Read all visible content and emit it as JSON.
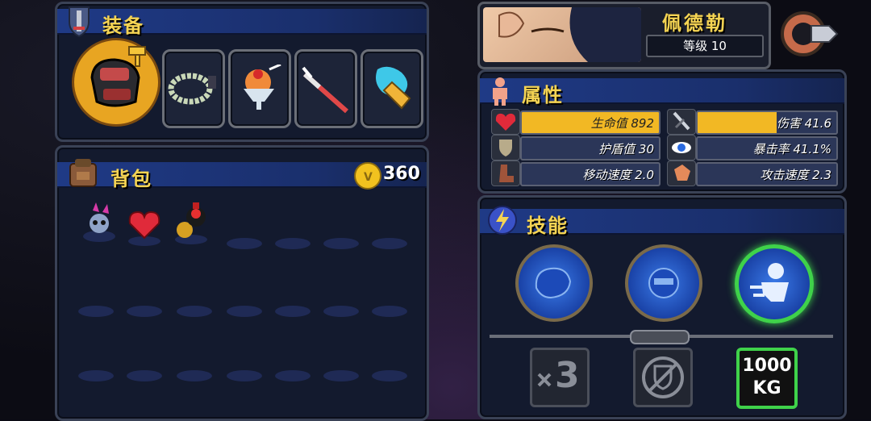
{
  "equipment": {
    "title": "装备",
    "slots": [
      "glove",
      "bracelet",
      "ice-cream",
      "spear",
      "flame-fist"
    ]
  },
  "backpack": {
    "title": "背包",
    "coins": "360",
    "items": [
      "skull-helmet",
      "heart",
      "potion"
    ]
  },
  "character": {
    "name": "佩德勒",
    "level": "等级 10"
  },
  "attributes": {
    "title": "属性",
    "left": [
      {
        "label": "生命值 892",
        "icon": "heart-icon",
        "fill": 1.0
      },
      {
        "label": "护盾值 30",
        "icon": "shield-icon",
        "fill": 0.0
      },
      {
        "label": "移动速度 2.0",
        "icon": "boot-icon",
        "fill": 0.0
      }
    ],
    "right": [
      {
        "label": "伤害 41.6",
        "icon": "sword-icon",
        "fill": 0.57
      },
      {
        "label": "暴击率 41.1%",
        "icon": "eye-icon",
        "fill": 0.0
      },
      {
        "label": "攻击速度 2.3",
        "icon": "fist-icon",
        "fill": 0.0
      }
    ]
  },
  "skills": {
    "title": "技能",
    "active": [
      "skill-punch",
      "skill-fist",
      "skill-dash"
    ],
    "passive": [
      "x3",
      "no-shield",
      "1000 KG"
    ],
    "passive_text": {
      "a": "3",
      "b": "1000",
      "c": "KG"
    }
  },
  "colors": {
    "accent": "#f5d453",
    "hp_bar": "#f2b824",
    "selected": "#3fd24a"
  }
}
